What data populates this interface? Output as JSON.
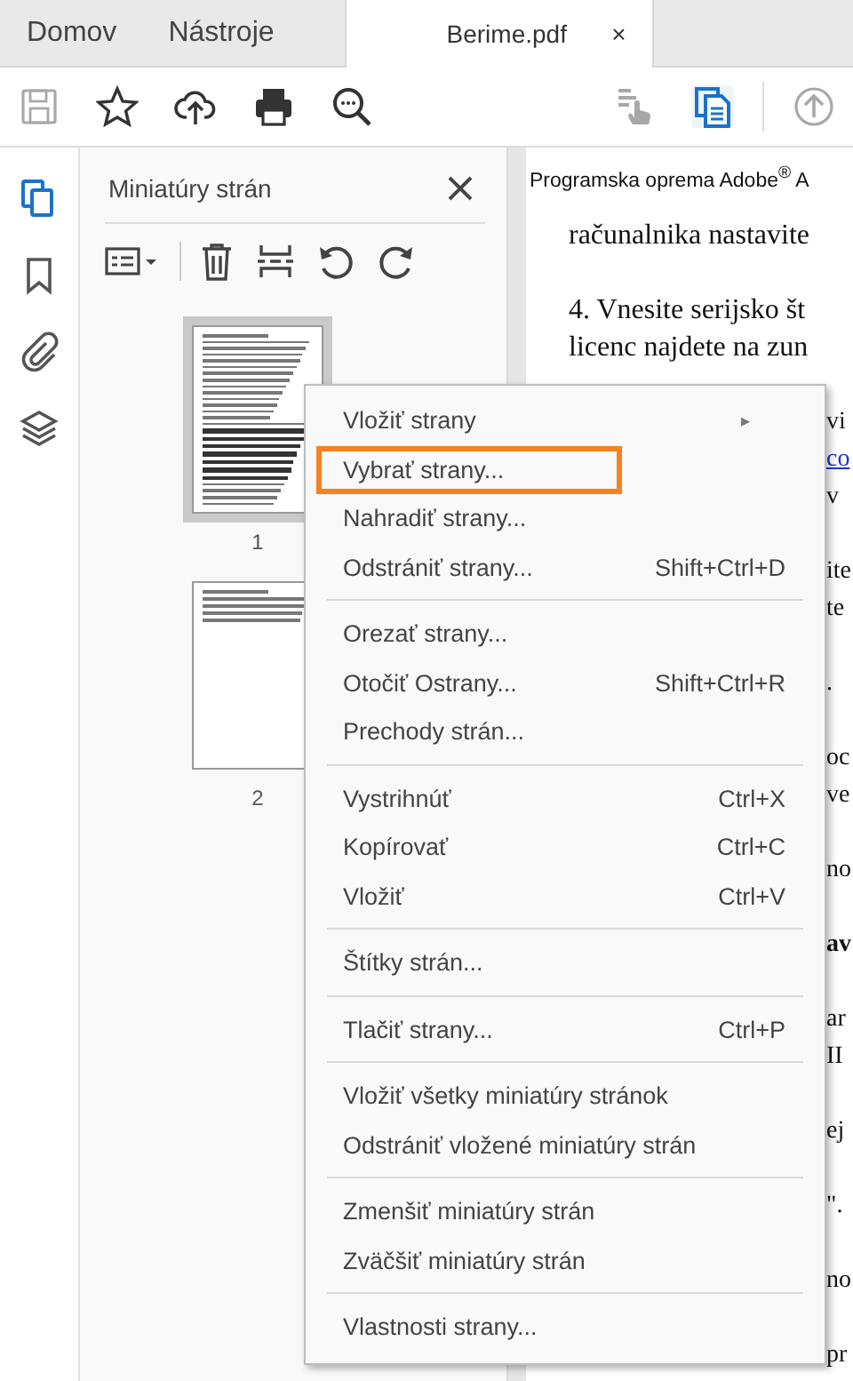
{
  "tabs": [
    {
      "label": "Domov",
      "selected": false
    },
    {
      "label": "Nástroje",
      "selected": false
    },
    {
      "label": "Berime.pdf",
      "selected": true,
      "close": "×"
    }
  ],
  "toolbar": [
    {
      "disabled": true,
      "selected": false
    },
    {
      "disabled": false,
      "selected": false
    },
    {
      "disabled": false,
      "selected": false
    },
    {
      "disabled": false,
      "selected": false
    },
    {
      "disabled": false,
      "selected": false
    },
    {
      "disabled": true,
      "selected": false
    },
    {
      "disabled": false,
      "selected": true
    },
    {
      "disabled": true,
      "selected": false
    }
  ],
  "rail": [
    {
      "selected": true
    },
    {
      "selected": false
    },
    {
      "selected": false
    },
    {
      "selected": false
    }
  ],
  "panel": {
    "title": "Miniatúry strán",
    "thumbnails": [
      {
        "label": "1",
        "selected": true
      },
      {
        "label": "2",
        "selected": false
      }
    ]
  },
  "document": {
    "header": "Programska oprema Adobe$^{®}$ A",
    "paragraphs": [
      [
        {
          "kind": "full",
          "text": "računalnika nastavite"
        }
      ],
      [
        {
          "kind": "full",
          "text": "4. Vnesite serijsko št"
        },
        {
          "kind": "full",
          "text": "licenc najdete na zun"
        },
        {
          "kind": "fragment",
          "text": "vi"
        },
        {
          "kind": "link",
          "text": "co"
        },
        {
          "kind": "fragment",
          "text": "v"
        }
      ],
      [
        {
          "kind": "fragment",
          "text": "ite"
        },
        {
          "kind": "fragment",
          "text": "te"
        }
      ],
      [
        {
          "kind": "fragment",
          "text": "."
        }
      ],
      [
        {
          "kind": "fragment",
          "text": "oc"
        },
        {
          "kind": "fragment",
          "text": "ve"
        }
      ],
      [
        {
          "kind": "fragment",
          "text": "no"
        }
      ],
      [
        {
          "kind": "heading",
          "text": "av"
        }
      ],
      [
        {
          "kind": "fragment",
          "text": "ar"
        },
        {
          "kind": "fragment",
          "text": "II"
        }
      ],
      [
        {
          "kind": "fragment",
          "text": "ej"
        }
      ],
      [
        {
          "kind": "fragment",
          "text": "\"."
        }
      ],
      [
        {
          "kind": "fragment",
          "text": "no"
        }
      ],
      [
        {
          "kind": "fragment",
          "text": "pr"
        }
      ]
    ]
  },
  "context_menu": {
    "items": [
      {
        "kind": "item",
        "label": "Vložiť strany",
        "submenu": "▸",
        "highlighted": false
      },
      {
        "kind": "item",
        "label": "Vybrať strany...",
        "highlighted": true
      },
      {
        "kind": "item",
        "label": "Nahradiť strany...",
        "highlighted": false
      },
      {
        "kind": "item",
        "label": "Odstrániť strany...",
        "shortcut": "Shift+Ctrl+D",
        "highlighted": false
      },
      {
        "kind": "separator"
      },
      {
        "kind": "item",
        "label": "Orezať strany...",
        "highlighted": false
      },
      {
        "kind": "item",
        "label": "Otočiť Ostrany...",
        "shortcut": "Shift+Ctrl+R",
        "highlighted": false
      },
      {
        "kind": "item",
        "label": "Prechody strán...",
        "highlighted": false
      },
      {
        "kind": "separator"
      },
      {
        "kind": "item",
        "label": "Vystrihnúť",
        "shortcut": "Ctrl+X",
        "highlighted": false
      },
      {
        "kind": "item",
        "label": "Kopírovať",
        "shortcut": "Ctrl+C",
        "highlighted": false
      },
      {
        "kind": "item",
        "label": "Vložiť",
        "shortcut": "Ctrl+V",
        "highlighted": false
      },
      {
        "kind": "separator"
      },
      {
        "kind": "item",
        "label": "Štítky strán...",
        "highlighted": false
      },
      {
        "kind": "separator"
      },
      {
        "kind": "item",
        "label": "Tlačiť strany...",
        "shortcut": "Ctrl+P",
        "highlighted": false
      },
      {
        "kind": "separator"
      },
      {
        "kind": "item",
        "label": "Vložiť všetky miniatúry stránok",
        "highlighted": false
      },
      {
        "kind": "item",
        "label": "Odstrániť vložené miniatúry strán",
        "highlighted": false
      },
      {
        "kind": "separator"
      },
      {
        "kind": "item",
        "label": "Zmenšiť miniatúry strán",
        "highlighted": false
      },
      {
        "kind": "item",
        "label": "Zväčšiť miniatúry strán",
        "highlighted": false
      },
      {
        "kind": "separator"
      },
      {
        "kind": "item",
        "label": "Vlastnosti strany...",
        "highlighted": false
      }
    ]
  }
}
